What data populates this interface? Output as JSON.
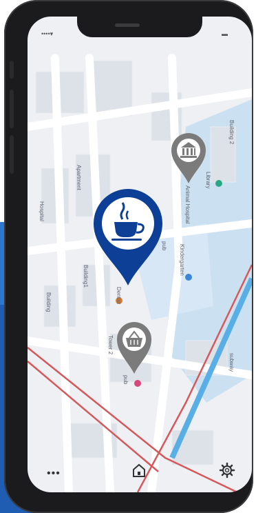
{
  "status_bar": {
    "signal_icon": "signal-wifi-icon",
    "battery_icon": "battery-icon"
  },
  "map": {
    "labels": {
      "building2": "Building 2",
      "library": "Library",
      "apartment": "Apartment",
      "hospital": "Hospital",
      "animal_hospital": "Animal Hospital",
      "kindergarten": "Kindergarten",
      "building1": "Building1",
      "dentist": "Dentist",
      "building": "Building",
      "tower2": "Tower 2",
      "pub": "pub",
      "subway": "subway",
      "pub2": "pub"
    },
    "pins": {
      "cafe": {
        "icon": "coffee-cup-icon",
        "color": "#0d3f97"
      },
      "museum": {
        "icon": "museum-icon",
        "color": "#7b7b7b"
      },
      "shop": {
        "icon": "shopping-basket-icon",
        "color": "#7b7b7b"
      }
    }
  },
  "bottom_bar": {
    "more_label": "•••",
    "home_icon": "home-icon",
    "settings_icon": "gear-icon"
  },
  "colors": {
    "accent": "#0d3f97",
    "water": "#5aaee6",
    "road_red": "#d5585b",
    "park": "#b5d8f0",
    "background_panel": "#1f5db3"
  }
}
